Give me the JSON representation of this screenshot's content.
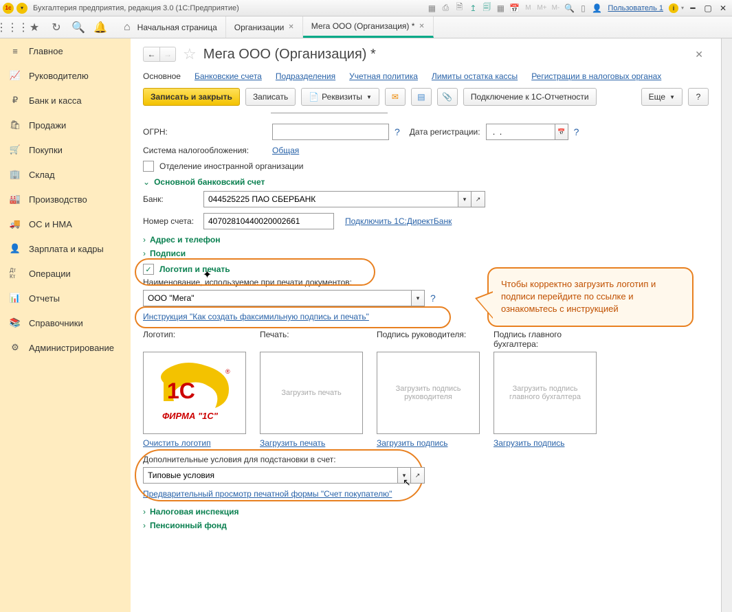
{
  "titlebar": {
    "app_title": "Бухгалтерия предприятия, редакция 3.0  (1С:Предприятие)",
    "user": "Пользователь 1"
  },
  "tabs": {
    "home": "Начальная страница",
    "org": "Организации",
    "mega": "Мега ООО (Организация) *"
  },
  "sidebar": [
    {
      "icon": "≡",
      "label": "Главное"
    },
    {
      "icon": "📈",
      "label": "Руководителю"
    },
    {
      "icon": "₽",
      "label": "Банк и касса"
    },
    {
      "icon": "🛍",
      "label": "Продажи"
    },
    {
      "icon": "🛒",
      "label": "Покупки"
    },
    {
      "icon": "🏢",
      "label": "Склад"
    },
    {
      "icon": "🏭",
      "label": "Производство"
    },
    {
      "icon": "🚚",
      "label": "ОС и НМА"
    },
    {
      "icon": "👤",
      "label": "Зарплата и кадры"
    },
    {
      "icon": "Дт Кт",
      "label": "Операции"
    },
    {
      "icon": "📊",
      "label": "Отчеты"
    },
    {
      "icon": "📚",
      "label": "Справочники"
    },
    {
      "icon": "⚙",
      "label": "Администрирование"
    }
  ],
  "page": {
    "title": "Мега ООО (Организация) *",
    "subnav": {
      "main": "Основное",
      "bank": "Банковские счета",
      "divisions": "Подразделения",
      "accounting": "Учетная политика",
      "limits": "Лимиты остатка кассы",
      "registrations": "Регистрации в налоговых органах"
    },
    "toolbar": {
      "save_close": "Записать и закрыть",
      "save": "Записать",
      "requisites": "Реквизиты",
      "connect": "Подключение к 1С-Отчетности",
      "more": "Еще"
    }
  },
  "form": {
    "ogrn_label": "ОГРН:",
    "ogrn_value": "",
    "reg_date_label": "Дата регистрации:",
    "reg_date_value": " .  .    ",
    "tax_label": "Система налогообложения:",
    "tax_value": "Общая",
    "sep_label": "Отделение иностранной организации",
    "bank_section": "Основной банковский счет",
    "bank_label": "Банк:",
    "bank_value": "044525225 ПАО СБЕРБАНК",
    "acc_label": "Номер счета:",
    "acc_value": "40702810440020002661",
    "direct_bank": "Подключить 1С:ДиректБанк",
    "address_section": "Адрес и телефон",
    "sign_section": "Подписи",
    "logo_section": "Логотип и печать",
    "print_name_label": "Наименование, используемое при печати документов:",
    "print_name_value": "ООО \"Мега\"",
    "instruction": "Инструкция \"Как создать факсимильную подпись и печать\"",
    "logo_labels": {
      "logo": "Логотип:",
      "stamp": "Печать:",
      "sign_head": "Подпись руководителя:",
      "sign_acc": "Подпись главного бухгалтера:"
    },
    "logo_placeholders": {
      "stamp": "Загрузить печать",
      "sign_head": "Загрузить  подпись руководителя",
      "sign_acc": "Загрузить подпись главного бухгалтера"
    },
    "logo_links": {
      "clear": "Очистить логотип",
      "load_stamp": "Загрузить печать",
      "load_sign1": "Загрузить подпись",
      "load_sign2": "Загрузить подпись"
    },
    "extra_label": "Дополнительные условия для подстановки в счет:",
    "extra_value": "Типовые условия",
    "preview": "Предварительный просмотр печатной формы \"Счет покупателю\"",
    "tax_insp_section": "Налоговая инспекция",
    "pension_section": "Пенсионный фонд"
  },
  "callout": "Чтобы корректно загрузить логотип и подписи перейдите по ссылке и ознакомьтесь с инструкцией",
  "logo_text": "ФИРМА \"1С\""
}
